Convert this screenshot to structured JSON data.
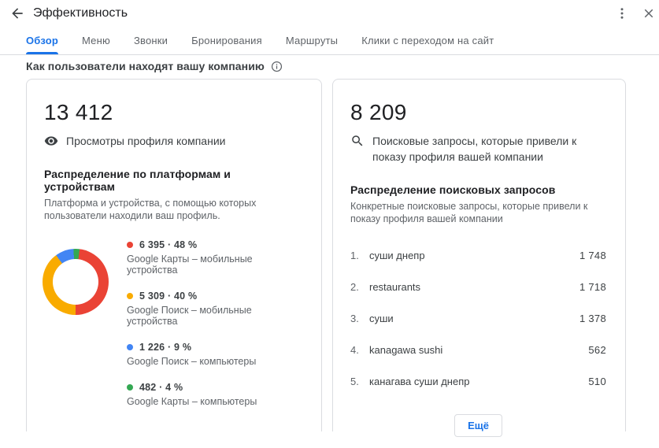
{
  "header": {
    "title": "Эффективность"
  },
  "tabs": [
    {
      "label": "Обзор",
      "active": true
    },
    {
      "label": "Меню",
      "active": false
    },
    {
      "label": "Звонки",
      "active": false
    },
    {
      "label": "Бронирования",
      "active": false
    },
    {
      "label": "Маршруты",
      "active": false
    },
    {
      "label": "Клики с переходом на сайт",
      "active": false
    }
  ],
  "section": {
    "title": "Как пользователи находят вашу компанию"
  },
  "views_card": {
    "value": "13 412",
    "caption": "Просмотры профиля компании",
    "breakdown_title": "Распределение по платформам и устройствам",
    "breakdown_description": "Платформа и устройства, с помощью которых пользователи находили ваш профиль."
  },
  "queries_card": {
    "value": "8 209",
    "caption": "Поисковые запросы, которые привели к показу профиля вашей компании",
    "breakdown_title": "Распределение поисковых запросов",
    "breakdown_description": "Конкретные поисковые запросы, которые привели к показу профиля вашей компании",
    "queries": [
      {
        "rank": "1.",
        "query": "суши днепр",
        "count": "1 748"
      },
      {
        "rank": "2.",
        "query": "restaurants",
        "count": "1 718"
      },
      {
        "rank": "3.",
        "query": "суши",
        "count": "1 378"
      },
      {
        "rank": "4.",
        "query": "kanagawa sushi",
        "count": "562"
      },
      {
        "rank": "5.",
        "query": "канагава суши днепр",
        "count": "510"
      }
    ],
    "more_label": "Ещё"
  },
  "chart_data": {
    "type": "pie",
    "donut": true,
    "title": "Распределение по платформам и устройствам",
    "total": 13412,
    "start_angle_deg": 7,
    "segments": [
      {
        "label": "Google Карты – мобильные устройства",
        "value": 6395,
        "percent": 48,
        "value_text": "6 395 · 48 %",
        "color": "#EA4335"
      },
      {
        "label": "Google Поиск – мобильные устройства",
        "value": 5309,
        "percent": 40,
        "value_text": "5 309 · 40 %",
        "color": "#F9AB00"
      },
      {
        "label": "Google Поиск – компьютеры",
        "value": 1226,
        "percent": 9,
        "value_text": "1 226 · 9 %",
        "color": "#4285F4"
      },
      {
        "label": "Google Карты – компьютеры",
        "value": 482,
        "percent": 4,
        "value_text": "482 · 4 %",
        "color": "#34A853"
      }
    ]
  },
  "colors": {
    "accent_blue": "#1a73e8",
    "border_gray": "#dadce0",
    "text_dark": "#202124",
    "text_gray": "#5f6368"
  }
}
